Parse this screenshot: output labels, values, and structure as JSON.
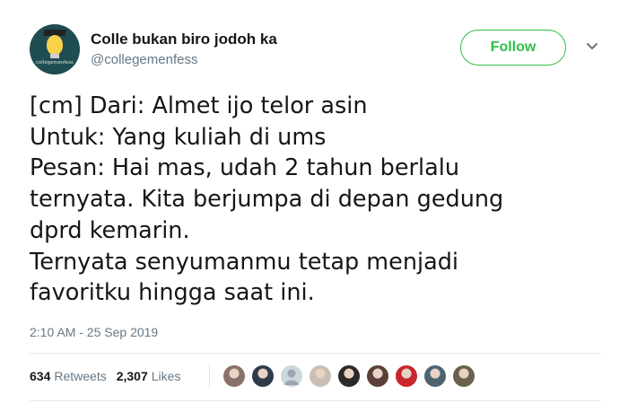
{
  "account": {
    "display_name": "Colle bukan biro jodoh ka",
    "handle": "@collegemenfess",
    "avatar_text": "collegemenfess",
    "avatar_color": "#1f4d52"
  },
  "follow_label": "Follow",
  "follow_color": "#2fbf45",
  "tweet_lines": [
    "[cm] Dari: Almet ijo telor asin",
    "Untuk: Yang kuliah di ums",
    "Pesan: Hai mas, udah 2 tahun berlalu",
    "ternyata. Kita berjumpa di depan gedung",
    "dprd kemarin.",
    "Ternyata senyumanmu tetap menjadi",
    "favoritku hingga saat ini."
  ],
  "timestamp": "2:10 AM - 25 Sep 2019",
  "stats": {
    "retweets_count": "634",
    "retweets_label": "Retweets",
    "likes_count": "2,307",
    "likes_label": "Likes"
  },
  "liker_avatars": [
    {
      "icon": "user-avatar",
      "color": "#8a6f6a"
    },
    {
      "icon": "user-avatar",
      "color": "#2f3b4a"
    },
    {
      "icon": "default-avatar",
      "color": "#9aa5b1"
    },
    {
      "icon": "user-avatar",
      "color": "#c9bfb3"
    },
    {
      "icon": "user-avatar",
      "color": "#2a2a2a"
    },
    {
      "icon": "user-avatar",
      "color": "#5a4038"
    },
    {
      "icon": "user-avatar",
      "color": "#c8262c"
    },
    {
      "icon": "user-avatar",
      "color": "#4d6470"
    },
    {
      "icon": "user-avatar",
      "color": "#6b5f4d"
    }
  ]
}
